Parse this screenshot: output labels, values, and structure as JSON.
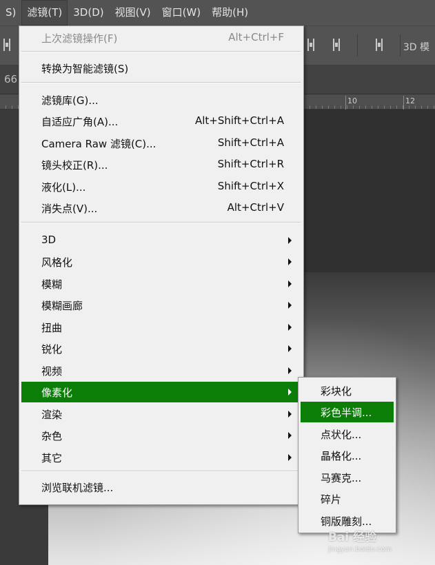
{
  "menubar": {
    "items": [
      {
        "label": "S)",
        "active": false
      },
      {
        "label": "滤镜(T)",
        "active": true
      },
      {
        "label": "3D(D)",
        "active": false
      },
      {
        "label": "视图(V)",
        "active": false
      },
      {
        "label": "窗口(W)",
        "active": false
      },
      {
        "label": "帮助(H)",
        "active": false
      }
    ]
  },
  "options_bar": {
    "label_3d": "3D 模"
  },
  "doc_info": {
    "zoom_fragment": "66"
  },
  "ruler": {
    "labels": [
      "10",
      "12"
    ]
  },
  "filter_menu": {
    "items": [
      {
        "type": "item",
        "label": "上次滤镜操作(F)",
        "shortcut": "Alt+Ctrl+F",
        "disabled": true
      },
      {
        "type": "separator"
      },
      {
        "type": "item",
        "label": "转换为智能滤镜(S)",
        "shortcut": ""
      },
      {
        "type": "separator"
      },
      {
        "type": "item",
        "label": "滤镜库(G)...",
        "shortcut": ""
      },
      {
        "type": "item",
        "label": "自适应广角(A)...",
        "shortcut": "Alt+Shift+Ctrl+A"
      },
      {
        "type": "item",
        "label": "Camera Raw 滤镜(C)...",
        "shortcut": "Shift+Ctrl+A"
      },
      {
        "type": "item",
        "label": "镜头校正(R)...",
        "shortcut": "Shift+Ctrl+R"
      },
      {
        "type": "item",
        "label": "液化(L)...",
        "shortcut": "Shift+Ctrl+X"
      },
      {
        "type": "item",
        "label": "消失点(V)...",
        "shortcut": "Alt+Ctrl+V"
      },
      {
        "type": "separator"
      },
      {
        "type": "submenu",
        "label": "3D"
      },
      {
        "type": "submenu",
        "label": "风格化"
      },
      {
        "type": "submenu",
        "label": "模糊"
      },
      {
        "type": "submenu",
        "label": "模糊画廊"
      },
      {
        "type": "submenu",
        "label": "扭曲"
      },
      {
        "type": "submenu",
        "label": "锐化"
      },
      {
        "type": "submenu",
        "label": "视频"
      },
      {
        "type": "submenu",
        "label": "像素化",
        "highlighted": true
      },
      {
        "type": "submenu",
        "label": "渲染"
      },
      {
        "type": "submenu",
        "label": "杂色"
      },
      {
        "type": "submenu",
        "label": "其它"
      },
      {
        "type": "separator"
      },
      {
        "type": "item",
        "label": "浏览联机滤镜...",
        "shortcut": ""
      }
    ]
  },
  "pixelate_submenu": {
    "items": [
      {
        "label": "彩块化",
        "highlighted": false
      },
      {
        "label": "彩色半调...",
        "highlighted": true
      },
      {
        "label": "点状化...",
        "highlighted": false
      },
      {
        "label": "晶格化...",
        "highlighted": false
      },
      {
        "label": "马赛克...",
        "highlighted": false
      },
      {
        "label": "碎片",
        "highlighted": false
      },
      {
        "label": "铜版雕刻...",
        "highlighted": false
      }
    ]
  },
  "watermark": {
    "text": "Bai 经验",
    "sub": "jingyan.baidu.com"
  },
  "colors": {
    "highlight": "#0a7e07",
    "menu_bg": "#f0f0f0",
    "chrome": "#535353"
  },
  "icons": [
    "submenu-arrow-icon",
    "align-tool-icon"
  ]
}
